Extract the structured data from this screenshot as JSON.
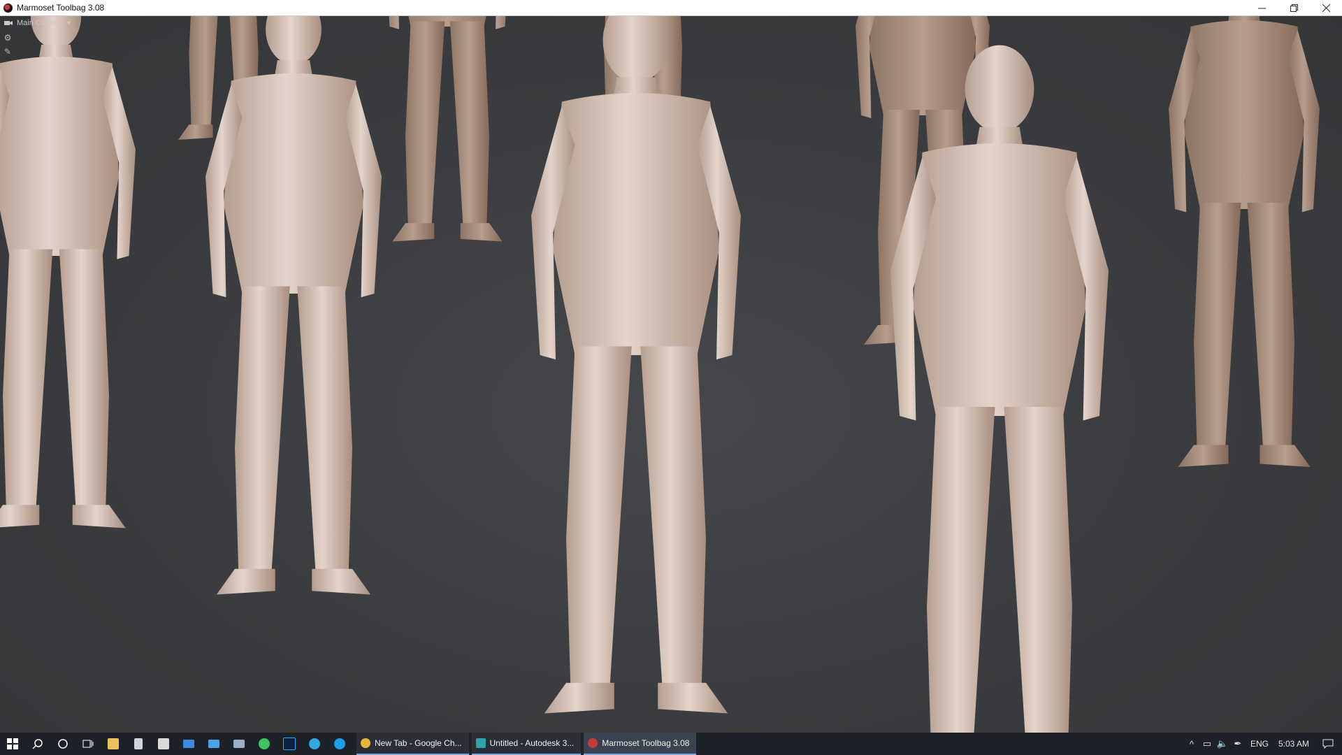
{
  "window": {
    "title": "Marmoset Toolbag 3.08",
    "controls": [
      "minimize-icon",
      "restore-icon",
      "close-icon"
    ]
  },
  "viewport": {
    "camera_label": "Main Camera",
    "tools": [
      "gear-icon",
      "pin-icon"
    ]
  },
  "taskbar": {
    "pinned": [
      "windows-start-icon",
      "search-icon",
      "cortana-icon",
      "task-view-icon",
      "file-explorer-icon",
      "calculator-icon",
      "store-icon",
      "mail-icon",
      "remote-desktop-icon",
      "network-icon",
      "whatsapp-icon",
      "photoshop-icon",
      "telegram-icon",
      "skype-icon"
    ],
    "apps": [
      {
        "label": "New Tab - Google Ch...",
        "icon": "chrome-icon",
        "color": "#e8b73a"
      },
      {
        "label": "Untitled - Autodesk 3...",
        "icon": "3dsmax-icon",
        "color": "#2ea3a8"
      },
      {
        "label": "Marmoset Toolbag 3.08",
        "icon": "marmoset-icon",
        "color": "#c43a3a"
      }
    ],
    "tray": {
      "language": "ENG",
      "time": "5:03 AM"
    }
  }
}
